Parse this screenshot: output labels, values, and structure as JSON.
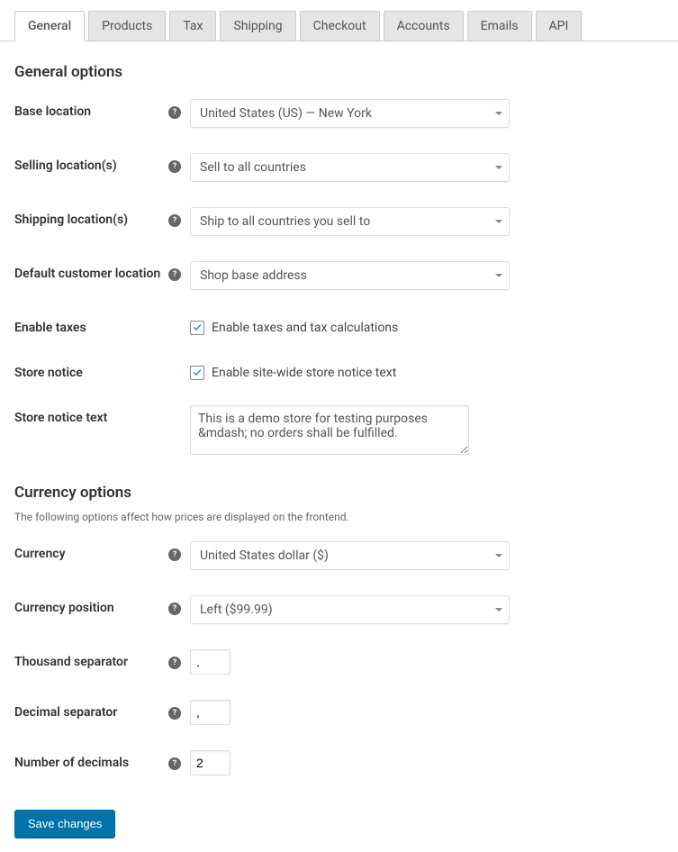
{
  "tabs": [
    {
      "label": "General",
      "active": true
    },
    {
      "label": "Products",
      "active": false
    },
    {
      "label": "Tax",
      "active": false
    },
    {
      "label": "Shipping",
      "active": false
    },
    {
      "label": "Checkout",
      "active": false
    },
    {
      "label": "Accounts",
      "active": false
    },
    {
      "label": "Emails",
      "active": false
    },
    {
      "label": "API",
      "active": false
    }
  ],
  "general": {
    "heading": "General options",
    "base_location": {
      "label": "Base location",
      "value": "United States (US) — New York"
    },
    "selling_locations": {
      "label": "Selling location(s)",
      "value": "Sell to all countries"
    },
    "shipping_locations": {
      "label": "Shipping location(s)",
      "value": "Ship to all countries you sell to"
    },
    "default_customer_location": {
      "label": "Default customer location",
      "value": "Shop base address"
    },
    "enable_taxes": {
      "label": "Enable taxes",
      "checkbox_label": "Enable taxes and tax calculations",
      "checked": true
    },
    "store_notice": {
      "label": "Store notice",
      "checkbox_label": "Enable site-wide store notice text",
      "checked": true
    },
    "store_notice_text": {
      "label": "Store notice text",
      "value": "This is a demo store for testing purposes &mdash; no orders shall be fulfilled."
    }
  },
  "currency": {
    "heading": "Currency options",
    "description": "The following options affect how prices are displayed on the frontend.",
    "currency": {
      "label": "Currency",
      "value": "United States dollar ($)"
    },
    "position": {
      "label": "Currency position",
      "value": "Left ($99.99)"
    },
    "thousand_separator": {
      "label": "Thousand separator",
      "value": "."
    },
    "decimal_separator": {
      "label": "Decimal separator",
      "value": ","
    },
    "number_of_decimals": {
      "label": "Number of decimals",
      "value": "2"
    }
  },
  "actions": {
    "save": "Save changes"
  }
}
